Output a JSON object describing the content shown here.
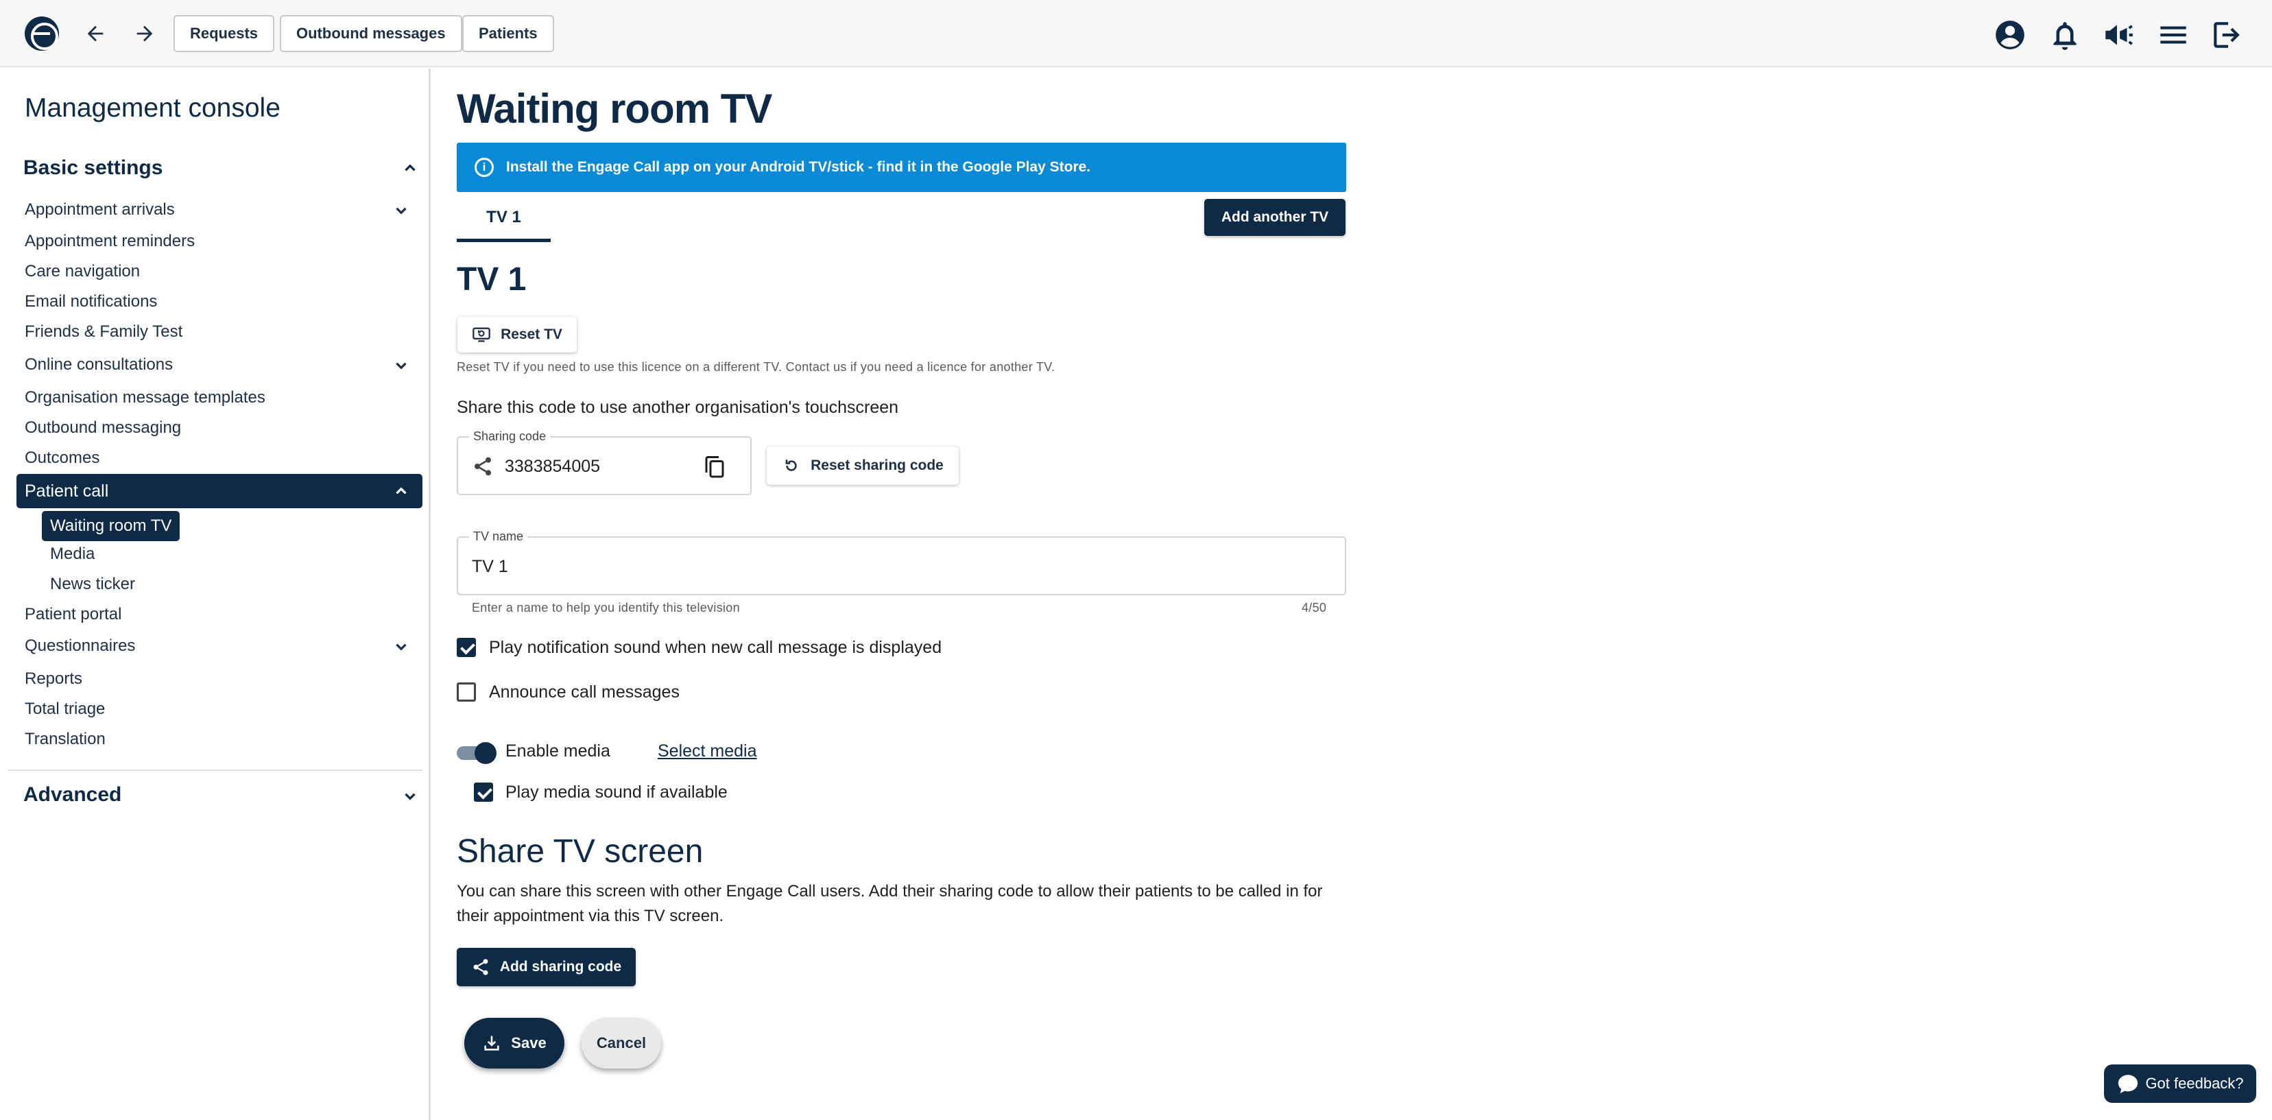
{
  "topbar": {
    "buttons": [
      "Requests",
      "Outbound messages",
      "Patients"
    ]
  },
  "sidebar": {
    "title": "Management console",
    "basic_settings": "Basic settings",
    "items": [
      "Appointment arrivals",
      "Appointment reminders",
      "Care navigation",
      "Email notifications",
      "Friends & Family Test",
      "Online consultations",
      "Organisation message templates",
      "Outbound messaging",
      "Outcomes",
      "Patient call",
      "Patient portal",
      "Questionnaires",
      "Reports",
      "Total triage",
      "Translation"
    ],
    "patient_call_sub": [
      "Waiting room TV",
      "Media",
      "News ticker"
    ],
    "advanced": "Advanced"
  },
  "main": {
    "title": "Waiting room TV",
    "banner": "Install the Engage Call app on your Android TV/stick - find it in the Google Play Store.",
    "tab": "TV 1",
    "add_tv": "Add another TV",
    "tv_heading": "TV 1",
    "reset_tv": "Reset TV",
    "reset_hint": "Reset TV if you need to use this licence on a different TV. Contact us if you need a licence for another TV.",
    "share_code_label": "Share this code to use another organisation's touchscreen",
    "sharing_code_label": "Sharing code",
    "sharing_code": "3383854005",
    "reset_sharing_code": "Reset sharing code",
    "tv_name_label": "TV name",
    "tv_name": "TV 1",
    "tv_name_hint": "Enter a name to help you identify this television",
    "tv_name_count": "4/50",
    "play_sound": "Play notification sound when new call message is displayed",
    "announce": "Announce call messages",
    "enable_media": "Enable media",
    "select_media": "Select media",
    "play_media_sound": "Play media sound if available",
    "share_title": "Share TV screen",
    "share_desc": "You can share this screen with other Engage Call users. Add their sharing code to allow their patients to be called in for their appointment via this TV screen.",
    "add_sharing_code": "Add sharing code",
    "save": "Save",
    "cancel": "Cancel"
  },
  "feedback": "Got feedback?",
  "colors": {
    "brand": "#0e2a47",
    "banner": "#0a8ad6"
  }
}
